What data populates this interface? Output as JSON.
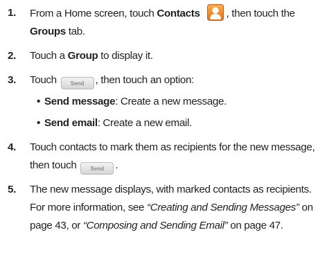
{
  "steps": [
    {
      "number": "1.",
      "a": "From a Home screen, touch ",
      "b": "Contacts",
      "c": ", then touch the ",
      "d": "Groups",
      "e": " tab."
    },
    {
      "number": "2.",
      "a": "Touch a ",
      "b": "Group",
      "c": " to display it."
    },
    {
      "number": "3.",
      "a": "Touch ",
      "b": ", then touch an option:",
      "bullets": [
        {
          "label": "Send message",
          "text": ": Create a new message."
        },
        {
          "label": "Send email",
          "text": ": Create a new email."
        }
      ]
    },
    {
      "number": "4.",
      "a": "Touch contacts to mark them as recipients for the new message, then touch ",
      "b": "."
    },
    {
      "number": "5.",
      "a": "The new message displays, with marked contacts as recipients. For more information, see ",
      "ref1": "“Creating and Sending Messages”",
      "b": " on page 43, or ",
      "ref2": "“Composing and Sending Email”",
      "c": " on page 47."
    }
  ],
  "send_button_label": "Send",
  "bullet_char": "•",
  "icons": {
    "contacts": "contacts-icon"
  },
  "colors": {
    "contacts_icon": "#f08a24",
    "text": "#222222"
  }
}
